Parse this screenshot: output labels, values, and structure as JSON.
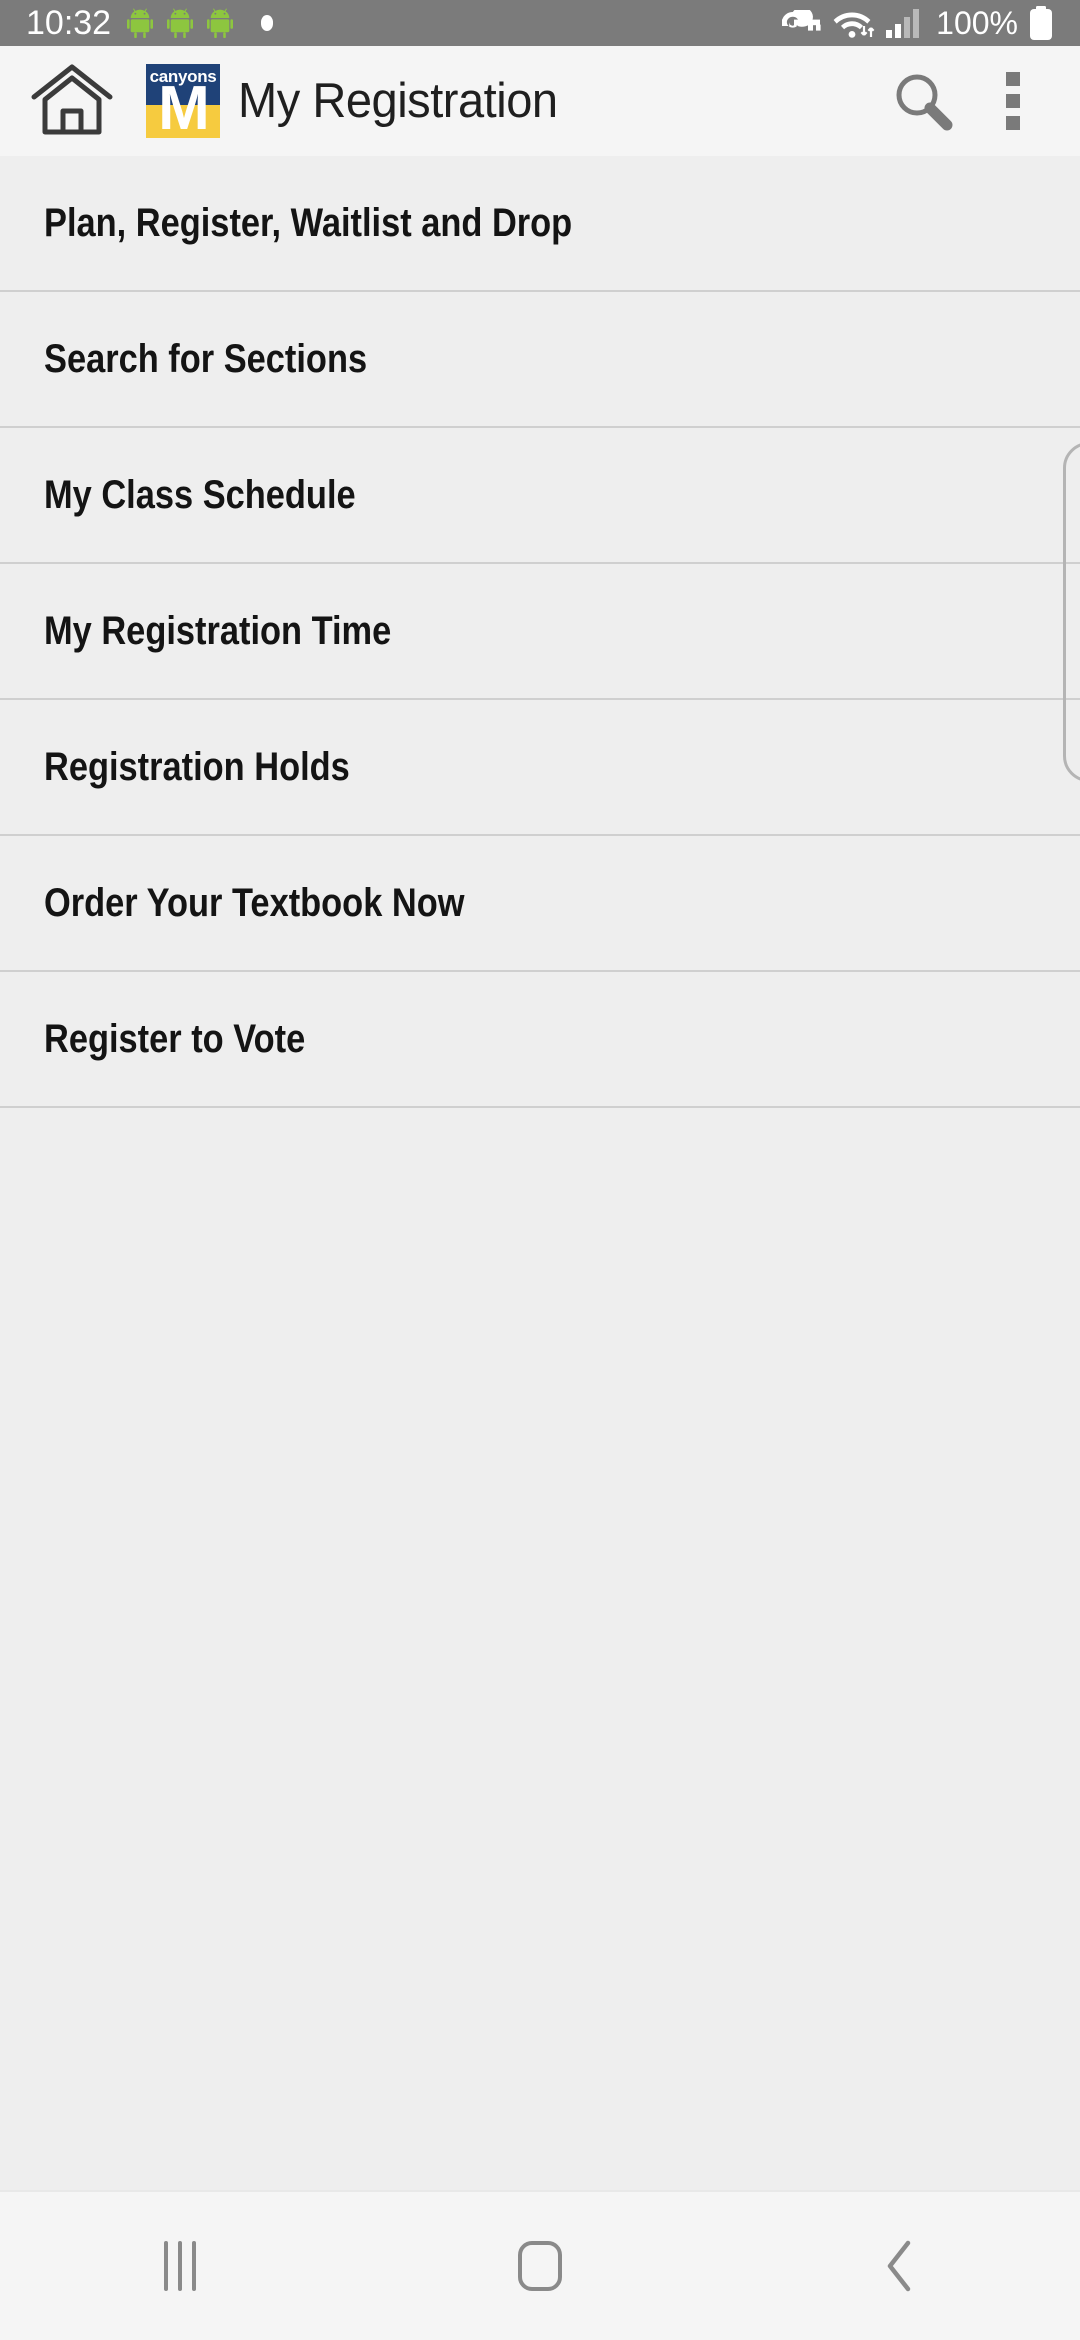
{
  "status_bar": {
    "time": "10:32",
    "battery_percent": "100%",
    "notification_icons": [
      "android-icon",
      "android-icon",
      "android-icon",
      "notification-dot"
    ],
    "system_icons": [
      "vpn-key-icon",
      "wifi-icon",
      "cellular-signal-icon",
      "battery-icon"
    ],
    "background_color": "#7b7b7b",
    "foreground_color": "#ffffff",
    "android_icon_color": "#8dc63f"
  },
  "app_bar": {
    "home_icon": "home-icon",
    "logo": {
      "word": "canyons",
      "letter": "M",
      "top_color": "#1f4278",
      "bottom_color": "#f6cb3f"
    },
    "title": "My Registration",
    "search_icon": "search-icon",
    "overflow_icon": "overflow-menu-icon",
    "background_color": "#f5f5f5"
  },
  "menu": {
    "items": [
      {
        "label": "Plan, Register, Waitlist and Drop"
      },
      {
        "label": "Search for Sections"
      },
      {
        "label": "My Class Schedule"
      },
      {
        "label": "My Registration Time"
      },
      {
        "label": "Registration Holds"
      },
      {
        "label": "Order Your Textbook Now"
      },
      {
        "label": "Register to Vote"
      }
    ],
    "background_color": "#eeeeee",
    "divider_color": "#cfcfcf",
    "text_color": "#141414"
  },
  "nav_bar": {
    "recents_icon": "recents-icon",
    "home_icon": "home-button-icon",
    "back_icon": "back-chevron-icon",
    "background_color": "#f5f5f5",
    "icon_color": "#8a8a8a"
  }
}
